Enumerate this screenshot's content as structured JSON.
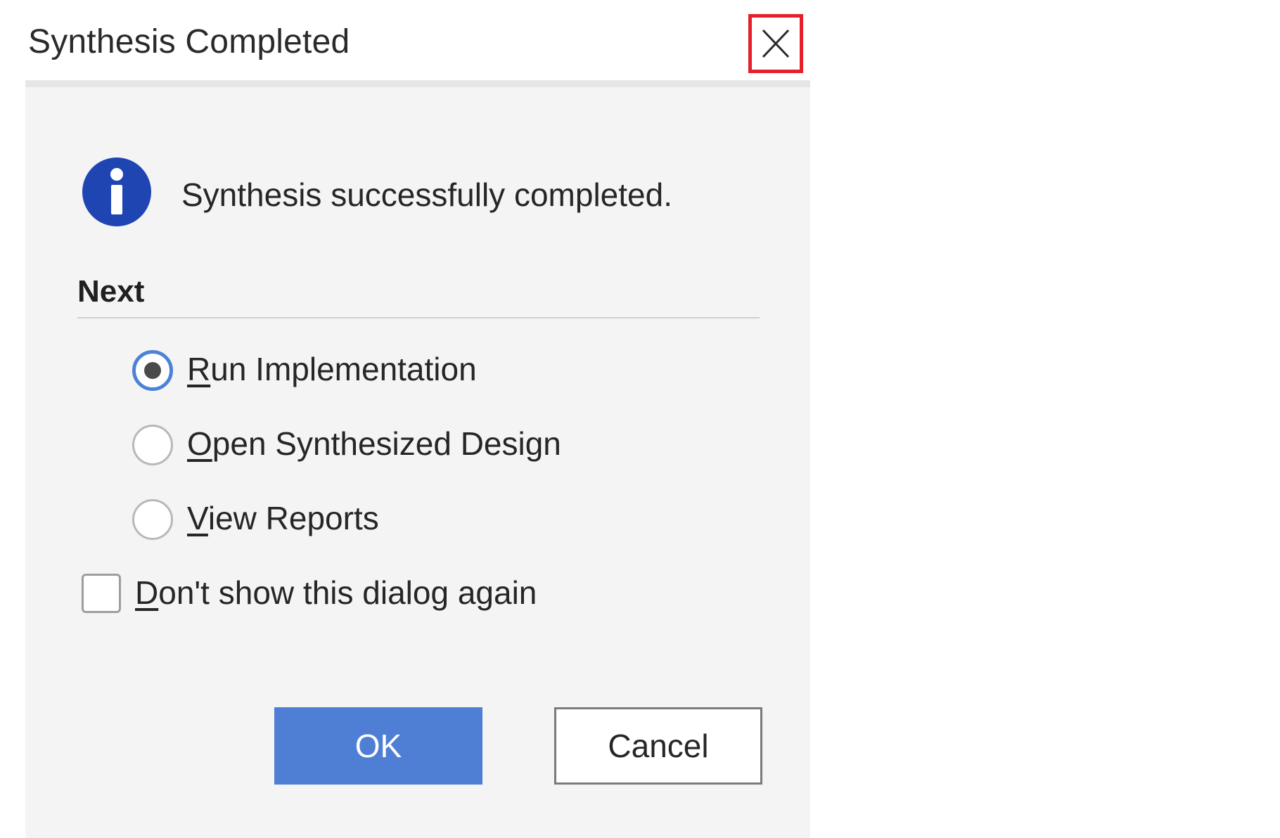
{
  "dialog": {
    "title": "Synthesis Completed",
    "message": "Synthesis successfully completed.",
    "section_title": "Next",
    "options": [
      {
        "mnemonic": "R",
        "rest": "un Implementation",
        "selected": true
      },
      {
        "mnemonic": "O",
        "rest": "pen Synthesized Design",
        "selected": false
      },
      {
        "mnemonic": "V",
        "rest": "iew Reports",
        "selected": false
      }
    ],
    "checkbox": {
      "mnemonic": "D",
      "rest": "on't show this dialog again",
      "checked": false
    },
    "ok_label": "OK",
    "cancel_label": "Cancel",
    "icons": {
      "close": "close-icon",
      "info": "info-icon"
    },
    "colors": {
      "highlight": "#e5202a",
      "accent": "#4e7fd4",
      "info_icon": "#1f45b3"
    }
  }
}
